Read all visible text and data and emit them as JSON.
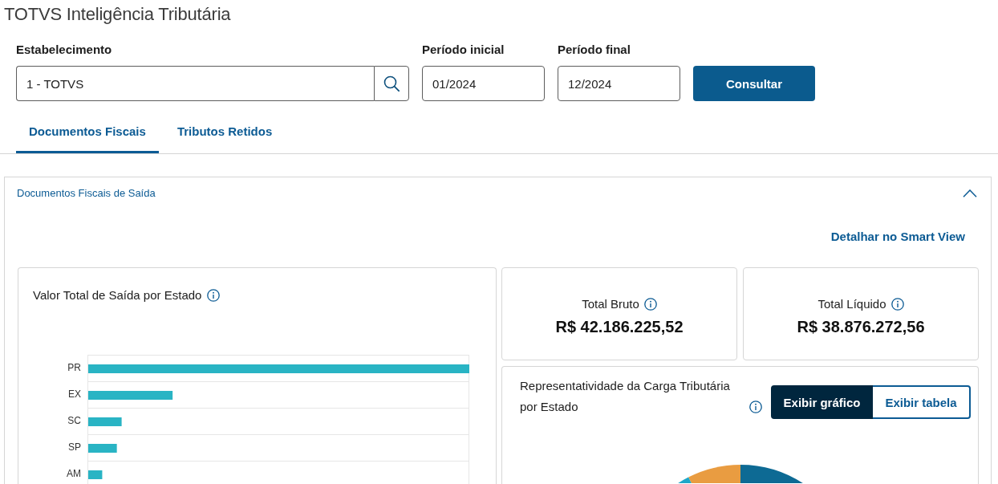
{
  "app_title": "TOTVS Inteligência Tributária",
  "filters": [
    {
      "kind": "lookup",
      "label": "Estabelecimento",
      "value": "1 - TOTVS"
    },
    {
      "kind": "date",
      "label": "Período inicial",
      "value": "01/2024"
    },
    {
      "kind": "date",
      "label": "Período final",
      "value": "12/2024"
    }
  ],
  "submit_button": "Consultar",
  "tabs": [
    {
      "label": "Documentos Fiscais",
      "selected": true
    },
    {
      "label": "Tributos Retidos",
      "selected": false
    }
  ],
  "panel": {
    "title": "Documentos Fiscais de Saída",
    "expanded": true,
    "link": "Detalhar no Smart View",
    "state_chart": {
      "title": "Valor Total de Saída por Estado",
      "categories": [
        "PR",
        "EX",
        "SC",
        "SP",
        "AM"
      ]
    },
    "totals": [
      {
        "label": "Total Bruto",
        "value": "R$ 42.186.225,52"
      },
      {
        "label": "Total Líquido",
        "value": "R$ 38.876.272,56"
      }
    ],
    "tax_share": {
      "title": "Representatividade da Carga Tributária por Estado",
      "view_options": [
        {
          "label": "Exibir gráfico",
          "selected": true
        },
        {
          "label": "Exibir tabela",
          "selected": false
        }
      ]
    }
  }
}
